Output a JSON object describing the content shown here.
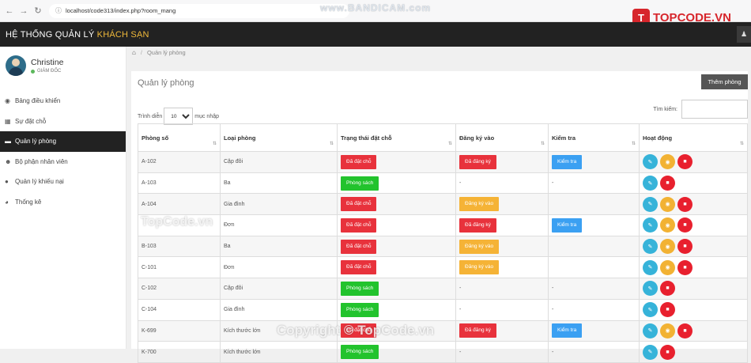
{
  "browser": {
    "url": "localhost/code313/index.php?room_mang"
  },
  "watermarks": {
    "bandicam": "www.BANDICAM.com",
    "logo": "TOPCODE.VN",
    "mid": "TopCode.vn",
    "bottom": "Copyright © TopCode.vn"
  },
  "header": {
    "brand_prefix": "HỆ THỐNG QUẢN LÝ",
    "brand_accent": "KHÁCH SẠN",
    "brand_accent_color": "#f0b93a"
  },
  "profile": {
    "name": "Christine",
    "role": "GIÁM ĐỐC"
  },
  "sidebar": {
    "items": [
      {
        "label": "Bảng điều khiển",
        "icon": "dashboard-icon"
      },
      {
        "label": "Sự đặt chỗ",
        "icon": "calendar-icon"
      },
      {
        "label": "Quản lý phòng",
        "icon": "bed-icon",
        "active": true
      },
      {
        "label": "Bộ phận nhân viên",
        "icon": "users-icon"
      },
      {
        "label": "Quản lý khiếu nại",
        "icon": "comments-icon"
      },
      {
        "label": "Thống kê",
        "icon": "chart-icon"
      }
    ]
  },
  "breadcrumb": {
    "current": "Quản lý phòng"
  },
  "panel": {
    "title": "Quản lý phòng",
    "add_button": "Thêm phòng"
  },
  "controls": {
    "show_label": "Trình diễn",
    "entries_label": "mục nhập",
    "entries_value": "10",
    "search_label": "Tìm kiếm:"
  },
  "table": {
    "headers": [
      "Phòng số",
      "Loại phòng",
      "Trạng thái đặt chỗ",
      "Đăng ký vào",
      "Kiểm tra",
      "Hoạt động"
    ],
    "rows": [
      {
        "room": "A-102",
        "type": "Cặp đôi",
        "status": {
          "label": "Đã đặt chỗ",
          "color": "red"
        },
        "checkin": {
          "label": "Đã đăng ký",
          "color": "red"
        },
        "checkout": {
          "label": "Kiểm tra",
          "color": "blue"
        },
        "actions": [
          "edit",
          "view",
          "delete"
        ]
      },
      {
        "room": "A-103",
        "type": "Ba",
        "status": {
          "label": "Phòng sách",
          "color": "green"
        },
        "checkin": {
          "label": "-"
        },
        "checkout": {
          "label": "-"
        },
        "actions": [
          "edit",
          "delete"
        ]
      },
      {
        "room": "A-104",
        "type": "Gia đình",
        "status": {
          "label": "Đã đặt chỗ",
          "color": "red"
        },
        "checkin": {
          "label": "Đăng ký vào",
          "color": "orange"
        },
        "checkout": {
          "label": ""
        },
        "actions": [
          "edit",
          "view",
          "delete"
        ]
      },
      {
        "room": "",
        "type": "Đơn",
        "status": {
          "label": "Đã đặt chỗ",
          "color": "red"
        },
        "checkin": {
          "label": "Đã đăng ký",
          "color": "red"
        },
        "checkout": {
          "label": "Kiểm tra",
          "color": "blue"
        },
        "actions": [
          "edit",
          "view",
          "delete"
        ]
      },
      {
        "room": "B-103",
        "type": "Ba",
        "status": {
          "label": "Đã đặt chỗ",
          "color": "red"
        },
        "checkin": {
          "label": "Đăng ký vào",
          "color": "orange"
        },
        "checkout": {
          "label": ""
        },
        "actions": [
          "edit",
          "view",
          "delete"
        ]
      },
      {
        "room": "C-101",
        "type": "Đơn",
        "status": {
          "label": "Đã đặt chỗ",
          "color": "red"
        },
        "checkin": {
          "label": "Đăng ký vào",
          "color": "orange"
        },
        "checkout": {
          "label": ""
        },
        "actions": [
          "edit",
          "view",
          "delete"
        ]
      },
      {
        "room": "C-102",
        "type": "Cặp đôi",
        "status": {
          "label": "Phòng sách",
          "color": "green"
        },
        "checkin": {
          "label": "-"
        },
        "checkout": {
          "label": "-"
        },
        "actions": [
          "edit",
          "delete"
        ]
      },
      {
        "room": "C-104",
        "type": "Gia đình",
        "status": {
          "label": "Phòng sách",
          "color": "green"
        },
        "checkin": {
          "label": "-"
        },
        "checkout": {
          "label": "-"
        },
        "actions": [
          "edit",
          "delete"
        ]
      },
      {
        "room": "K-699",
        "type": "Kích thước lớn",
        "status": {
          "label": "Đã đặt chỗ",
          "color": "red"
        },
        "checkin": {
          "label": "Đã đăng ký",
          "color": "red"
        },
        "checkout": {
          "label": "Kiểm tra",
          "color": "blue"
        },
        "actions": [
          "edit",
          "view",
          "delete"
        ]
      },
      {
        "room": "K-700",
        "type": "Kích thước lớn",
        "status": {
          "label": "Phòng sách",
          "color": "green"
        },
        "checkin": {
          "label": "-"
        },
        "checkout": {
          "label": "-"
        },
        "actions": [
          "edit",
          "delete"
        ]
      }
    ]
  }
}
